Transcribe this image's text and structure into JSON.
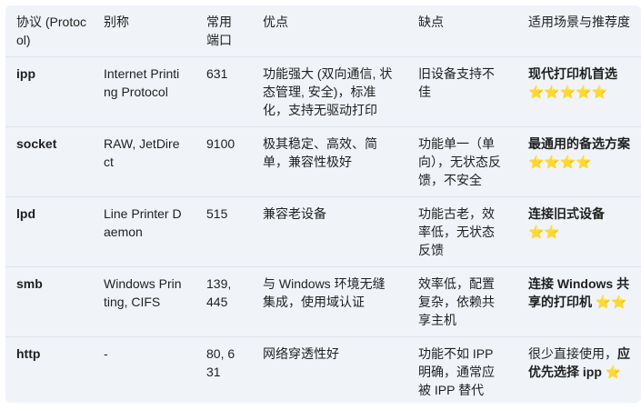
{
  "table": {
    "headers": [
      "协议 (Protocol)",
      "别称",
      "常用端口",
      "优点",
      "缺点",
      "适用场景与推荐度"
    ],
    "rows": [
      {
        "protocol": "ipp",
        "alias": "Internet Printing Protocol",
        "port": "631",
        "pros": "功能强大 (双向通信, 状态管理, 安全)，标准化，支持无驱动打印",
        "cons": "旧设备支持不佳",
        "scene_bold": "现代打印机首选",
        "scene_normal": "",
        "scene_bold_tail": "",
        "stars": "⭐⭐⭐⭐⭐"
      },
      {
        "protocol": "socket",
        "alias": "RAW, JetDirect",
        "port": "9100",
        "pros": "极其稳定、高效、简单，兼容性极好",
        "cons": "功能单一（单向），无状态反馈，不安全",
        "scene_bold": "最通用的备选方案",
        "scene_normal": "",
        "scene_bold_tail": "",
        "stars": "⭐⭐⭐⭐"
      },
      {
        "protocol": "lpd",
        "alias": "Line Printer Daemon",
        "port": "515",
        "pros": "兼容老设备",
        "cons": "功能古老，效率低，无状态反馈",
        "scene_bold": "连接旧式设备",
        "scene_normal": "",
        "scene_bold_tail": "",
        "stars": "⭐⭐"
      },
      {
        "protocol": "smb",
        "alias": "Windows Printing, CIFS",
        "port": "139, 445",
        "pros": "与 Windows 环境无缝集成，使用域认证",
        "cons": "效率低，配置复杂，依赖共享主机",
        "scene_bold": "连接 Windows 共享的打印机",
        "scene_normal": "",
        "scene_bold_tail": "",
        "stars": "⭐⭐"
      },
      {
        "protocol": "http",
        "alias": "-",
        "port": "80, 631",
        "pros": "网络穿透性好",
        "cons": "功能不如 IPP 明确，通常应被 IPP 替代",
        "scene_bold": "",
        "scene_normal": "很少直接使用，",
        "scene_bold_tail": "应优先选择 ipp",
        "stars": "⭐"
      }
    ]
  }
}
